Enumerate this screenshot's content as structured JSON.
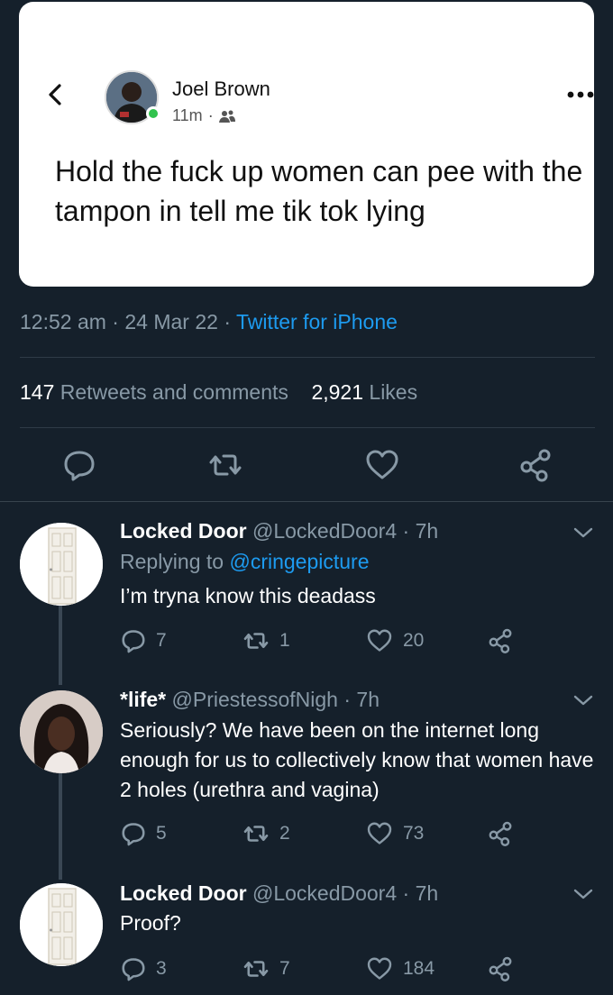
{
  "post": {
    "author": "Joel Brown",
    "time": "11m",
    "separator": "·",
    "text": "Hold the fuck up women can pee with the tampon in tell me tik tok lying"
  },
  "tweet_meta": {
    "time": "12:52 am",
    "date": "24 Mar 22",
    "client": "Twitter for iPhone"
  },
  "stats": {
    "retweets_count": "147",
    "retweets_label": "Retweets and comments",
    "likes_count": "2,921",
    "likes_label": "Likes"
  },
  "replies": [
    {
      "name": "Locked Door",
      "handle": "@LockedDoor4",
      "time": "7h",
      "replying_label": "Replying to",
      "replying_to": "@cringepicture",
      "text": "I’m tryna know this deadass",
      "replies": "7",
      "retweets": "1",
      "likes": "20"
    },
    {
      "name": "*life*",
      "handle": "@PriestessofNigh",
      "time": "7h",
      "text": "Seriously? We have been on the internet long enough for us to collectively know that women have 2 holes (urethra and vagina)",
      "replies": "5",
      "retweets": "2",
      "likes": "73"
    },
    {
      "name": "Locked Door",
      "handle": "@LockedDoor4",
      "time": "7h",
      "text": "Proof?",
      "replies": "3",
      "retweets": "7",
      "likes": "184"
    }
  ],
  "colors": {
    "background": "#15202b",
    "muted": "#8899a6",
    "link": "#1d9bf0",
    "online": "#31c24d"
  }
}
